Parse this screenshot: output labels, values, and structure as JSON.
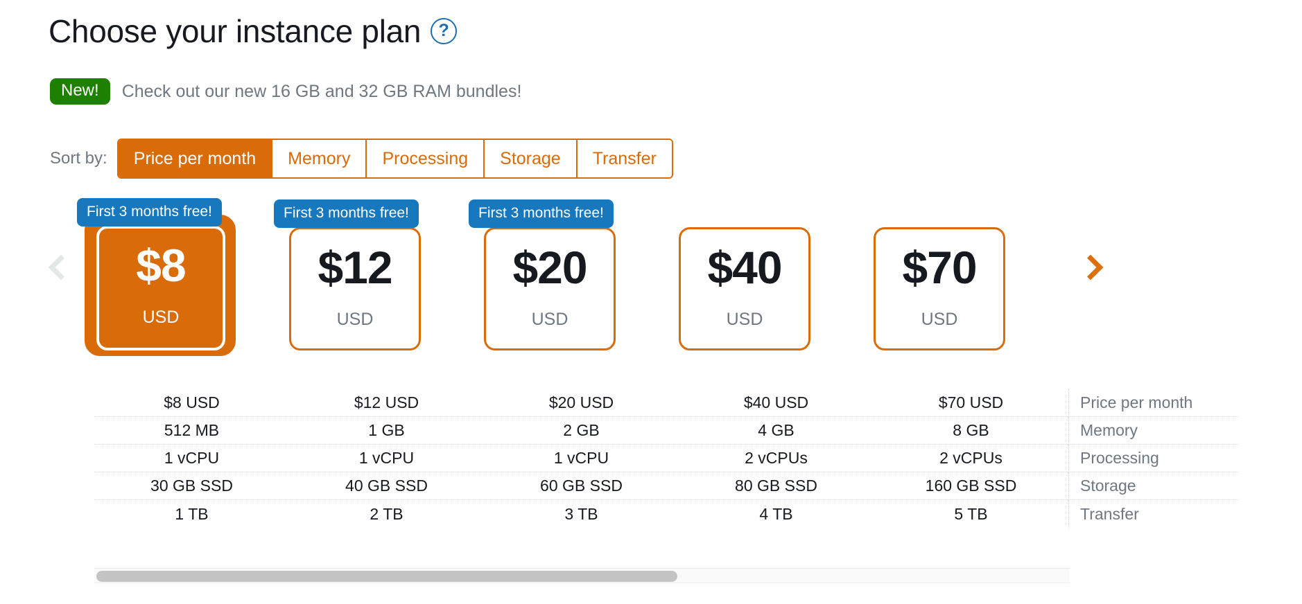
{
  "header": {
    "title": "Choose your instance plan",
    "help_icon": "question-mark-icon",
    "help_label": "?"
  },
  "promo": {
    "badge": "New!",
    "message": "Check out our new 16 GB and 32 GB RAM bundles!",
    "badge_color": "#1e8000"
  },
  "sort": {
    "label": "Sort by:",
    "accent_color": "#da6b09",
    "selected": "Price per month",
    "options": [
      {
        "label": "Price per month",
        "active": true
      },
      {
        "label": "Memory",
        "active": false
      },
      {
        "label": "Processing",
        "active": false
      },
      {
        "label": "Storage",
        "active": false
      },
      {
        "label": "Transfer",
        "active": false
      }
    ]
  },
  "carousel": {
    "prev_icon": "chevron-left-icon",
    "next_icon": "chevron-right-icon",
    "prev_enabled": false,
    "next_enabled": true,
    "prev_color": "#e3e7e8",
    "next_color": "#de6e0c",
    "badge_color": "#1878be"
  },
  "plans": [
    {
      "price": "$8",
      "currency": "USD",
      "badge": "First 3 months free!",
      "selected": true
    },
    {
      "price": "$12",
      "currency": "USD",
      "badge": "First 3 months free!",
      "selected": false
    },
    {
      "price": "$20",
      "currency": "USD",
      "badge": "First 3 months free!",
      "selected": false
    },
    {
      "price": "$40",
      "currency": "USD",
      "badge": null,
      "selected": false
    },
    {
      "price": "$70",
      "currency": "USD",
      "badge": null,
      "selected": false
    }
  ],
  "spec_table": {
    "row_labels": [
      "Price per month",
      "Memory",
      "Processing",
      "Storage",
      "Transfer"
    ],
    "rows": [
      {
        "label": "Price per month",
        "values": [
          "$8 USD",
          "$12 USD",
          "$20 USD",
          "$40 USD",
          "$70 USD"
        ]
      },
      {
        "label": "Memory",
        "values": [
          "512 MB",
          "1 GB",
          "2 GB",
          "4 GB",
          "8 GB"
        ]
      },
      {
        "label": "Processing",
        "values": [
          "1 vCPU",
          "1 vCPU",
          "1 vCPU",
          "2 vCPUs",
          "2 vCPUs"
        ]
      },
      {
        "label": "Storage",
        "values": [
          "30 GB SSD",
          "40 GB SSD",
          "60 GB SSD",
          "80 GB SSD",
          "160 GB SSD"
        ]
      },
      {
        "label": "Transfer",
        "values": [
          "1 TB",
          "2 TB",
          "3 TB",
          "4 TB",
          "5 TB"
        ]
      }
    ]
  },
  "scrollbar": {
    "orientation": "horizontal",
    "thumb_fraction": 0.6
  }
}
